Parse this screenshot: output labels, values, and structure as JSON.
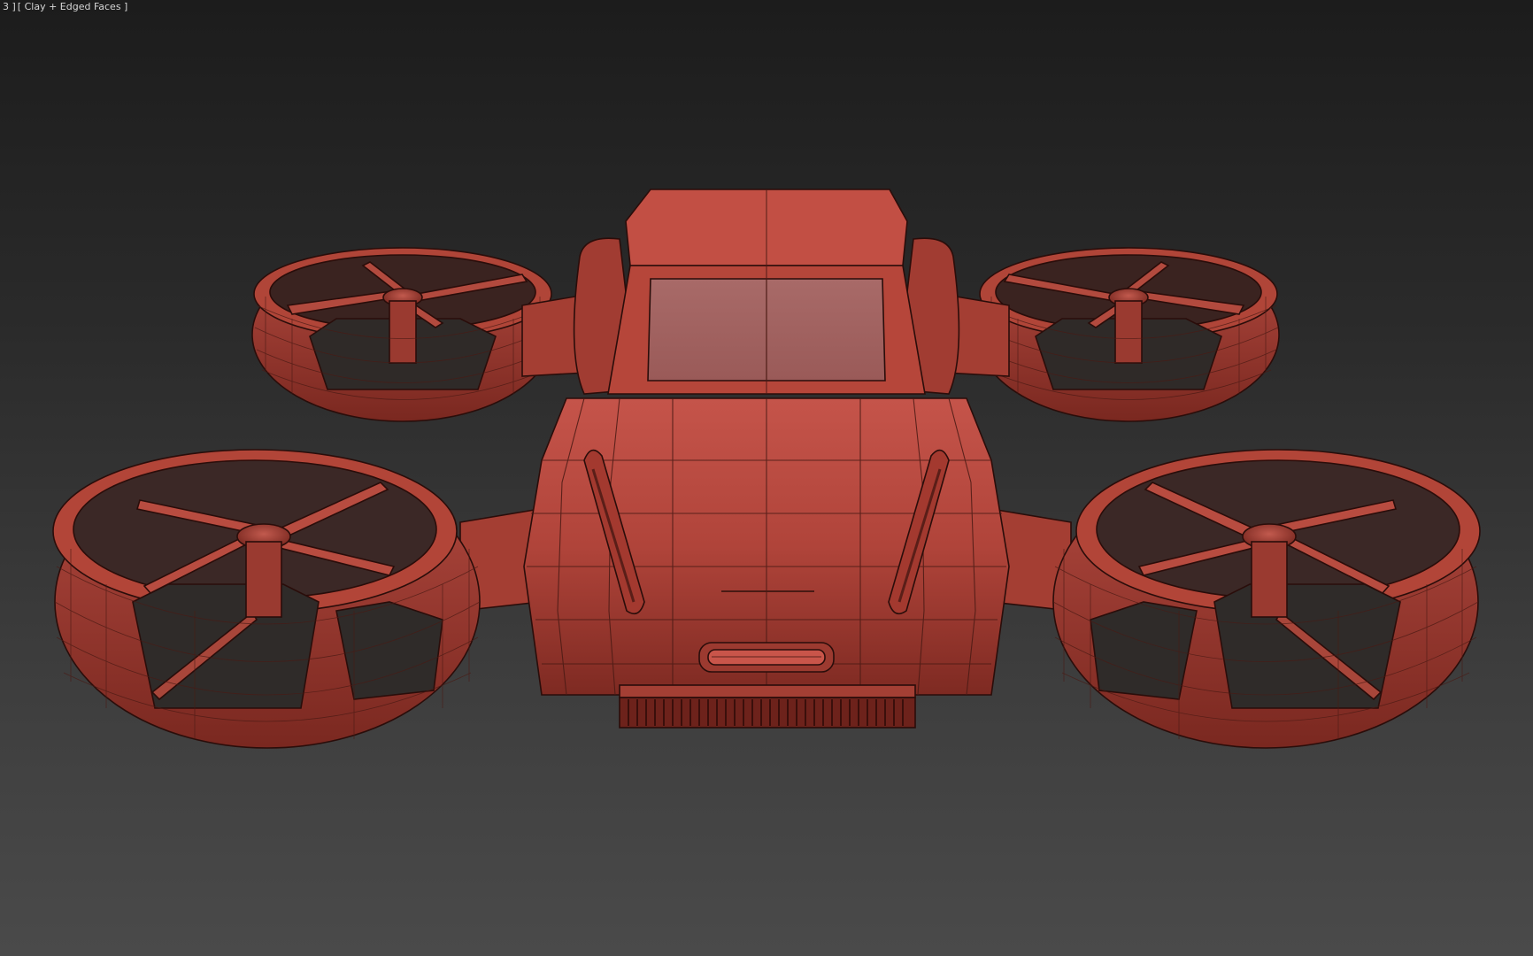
{
  "viewport": {
    "label_left": "3 ]",
    "label_shading": "[ Clay + Edged Faces ]",
    "model_color": "#b8493b",
    "wire_color": "#4a1a14",
    "background_top": "#1c1c1c",
    "background_bottom": "#4a4a4a"
  }
}
